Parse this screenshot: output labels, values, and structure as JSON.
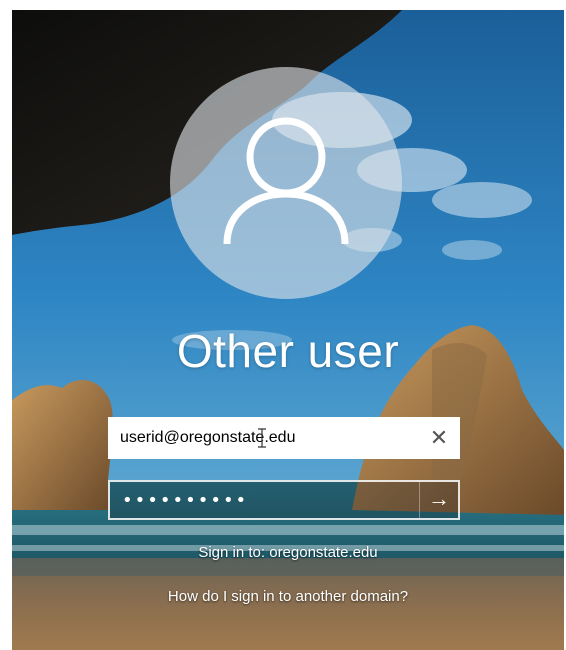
{
  "login": {
    "title": "Other user",
    "username": {
      "value": "userid@oregonstate.edu",
      "clear_icon": "close-icon",
      "clear_glyph": "✕"
    },
    "password": {
      "masked_value": "••••••••••",
      "submit_icon": "arrow-right-icon",
      "submit_glyph": "→"
    },
    "sign_in_to": "Sign in to: oregonstate.edu",
    "other_domain_link": "How do I sign in to another domain?"
  },
  "colors": {
    "sky": "#1f78b8",
    "avatar_circle": "#dde3e7",
    "text": "#ffffff"
  }
}
